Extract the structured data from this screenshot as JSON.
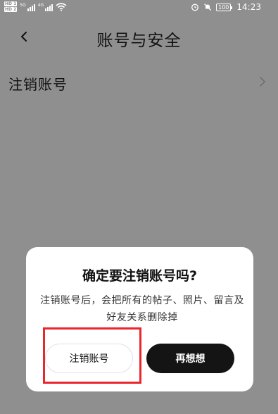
{
  "status_bar": {
    "hd1": "HD 1",
    "hd2": "HD 2",
    "net1": "5G",
    "net2": "4G",
    "battery": "100",
    "time": "14:23"
  },
  "header": {
    "title": "账号与安全"
  },
  "settings": {
    "items": [
      {
        "label": "注销账号"
      }
    ]
  },
  "dialog": {
    "title": "确定要注销账号吗?",
    "message": "注销账号后，会把所有的帖子、照片、留言及好友关系删除掉",
    "confirm_label": "注销账号",
    "cancel_label": "再想想"
  },
  "colors": {
    "overlay": "#8f8f8f",
    "highlight": "#e8262c",
    "dark_button": "#141414"
  }
}
